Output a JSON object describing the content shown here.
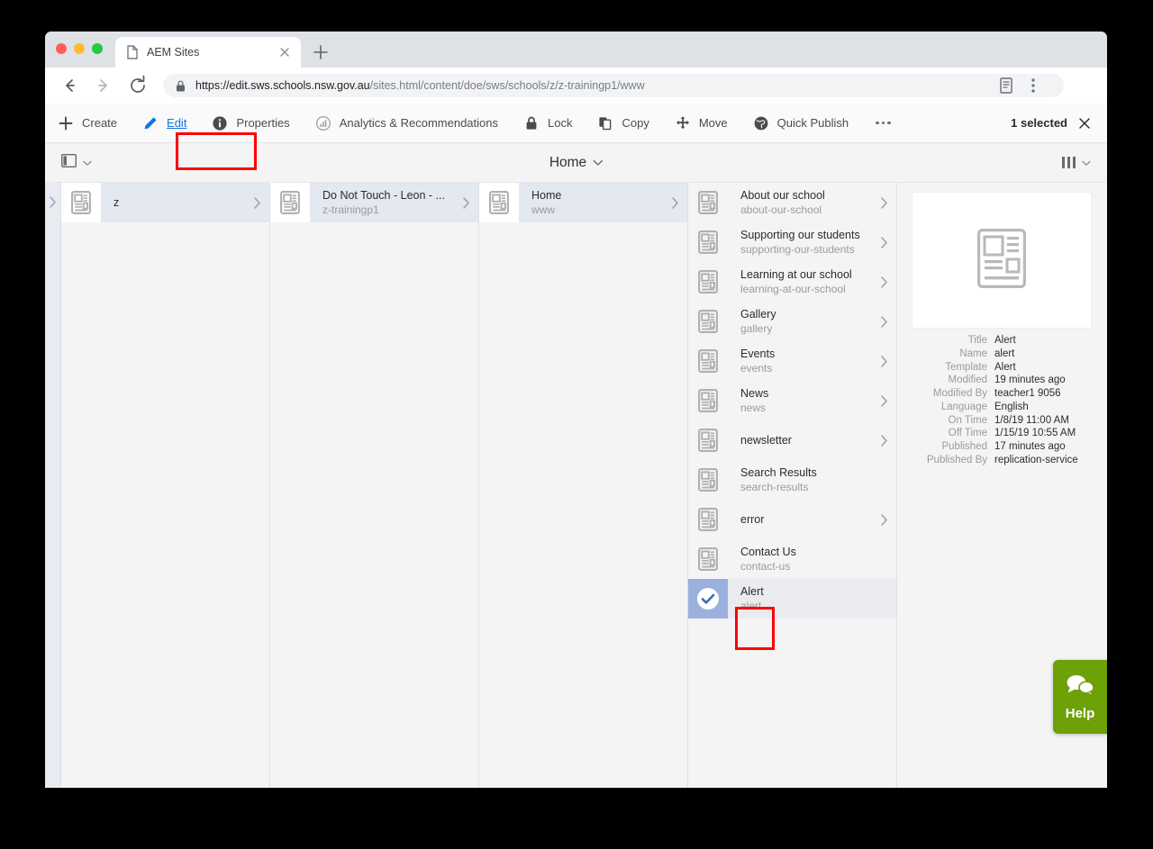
{
  "browser": {
    "tab": {
      "title": "AEM Sites",
      "favicon": "page-icon",
      "close": "close-icon"
    },
    "new_tab": "new-tab-icon",
    "nav": {
      "back": "back-arrow-icon",
      "forward": "forward-arrow-icon",
      "reload": "reload-icon"
    },
    "omnibox": {
      "lock": "lock-icon",
      "url_host": "https://edit.sws.schools.nsw.gov.au",
      "url_path": "/sites.html/content/doe/sws/schools/z/z-trainingp1/www",
      "reader": "reader-mode-icon",
      "menu": "browser-menu-icon"
    }
  },
  "action_bar": {
    "items": [
      {
        "id": "create",
        "label": "Create",
        "icon": "plus-icon"
      },
      {
        "id": "edit",
        "label": "Edit",
        "icon": "pencil-icon"
      },
      {
        "id": "properties",
        "label": "Properties",
        "icon": "info-icon"
      },
      {
        "id": "analytics",
        "label": "Analytics & Recommendations",
        "icon": "analytics-icon"
      },
      {
        "id": "lock",
        "label": "Lock",
        "icon": "lock-icon"
      },
      {
        "id": "copy",
        "label": "Copy",
        "icon": "copy-icon"
      },
      {
        "id": "move",
        "label": "Move",
        "icon": "move-icon"
      },
      {
        "id": "publish",
        "label": "Quick Publish",
        "icon": "globe-icon"
      }
    ],
    "more": "more-icon",
    "selection_count": "1 selected",
    "clear": "close-icon",
    "edit_accent_color": "#1473e6"
  },
  "rail_bar": {
    "rail_toggle_icon": "rail-panel-icon",
    "breadcrumb_label": "Home",
    "breadcrumb_caret": "chevron-down-icon",
    "view_switch_icon": "column-view-icon",
    "view_switch_caret": "chevron-down-icon"
  },
  "columns": [
    {
      "id": "col-0",
      "rows": [],
      "edge_chevron": "chevron-right-icon"
    },
    {
      "id": "col-1",
      "rows": [
        {
          "title": "z",
          "sub": "",
          "state": "active",
          "icon": "page-template-icon",
          "chevron": "chevron-right-icon"
        }
      ]
    },
    {
      "id": "col-2",
      "rows": [
        {
          "title": "Do Not Touch - Leon - ...",
          "sub": "z-trainingp1",
          "state": "active",
          "icon": "page-template-icon",
          "chevron": "chevron-right-icon"
        }
      ]
    },
    {
      "id": "col-3",
      "rows": [
        {
          "title": "Home",
          "sub": "www",
          "state": "active",
          "icon": "page-template-icon",
          "chevron": "chevron-right-icon"
        }
      ]
    },
    {
      "id": "col-4",
      "rows": [
        {
          "title": "About our school",
          "sub": "about-our-school",
          "state": "normal",
          "icon": "page-template-icon",
          "chevron": "chevron-right-icon"
        },
        {
          "title": "Supporting our students",
          "sub": "supporting-our-students",
          "state": "normal",
          "icon": "page-template-icon",
          "chevron": "chevron-right-icon"
        },
        {
          "title": "Learning at our school",
          "sub": "learning-at-our-school",
          "state": "normal",
          "icon": "page-template-icon",
          "chevron": "chevron-right-icon"
        },
        {
          "title": "Gallery",
          "sub": "gallery",
          "state": "normal",
          "icon": "page-template-icon",
          "chevron": "chevron-right-icon"
        },
        {
          "title": "Events",
          "sub": "events",
          "state": "normal",
          "icon": "page-template-icon",
          "chevron": "chevron-right-icon"
        },
        {
          "title": "News",
          "sub": "news",
          "state": "normal",
          "icon": "page-template-icon",
          "chevron": "chevron-right-icon"
        },
        {
          "title": "newsletter",
          "sub": "",
          "state": "normal",
          "icon": "page-template-icon",
          "chevron": "chevron-right-icon"
        },
        {
          "title": "Search Results",
          "sub": "search-results",
          "state": "normal",
          "icon": "page-template-icon",
          "chevron": ""
        },
        {
          "title": "error",
          "sub": "",
          "state": "normal",
          "icon": "page-template-icon",
          "chevron": "chevron-right-icon"
        },
        {
          "title": "Contact Us",
          "sub": "contact-us",
          "state": "normal",
          "icon": "page-template-icon",
          "chevron": ""
        },
        {
          "title": "Alert",
          "sub": "alert",
          "state": "selected",
          "icon": "checkmark-circle-icon",
          "chevron": ""
        }
      ]
    }
  ],
  "detail": {
    "thumbnail_icon": "page-template-icon",
    "properties": [
      {
        "key": "Title",
        "value": "Alert"
      },
      {
        "key": "Name",
        "value": "alert"
      },
      {
        "key": "Template",
        "value": "Alert"
      },
      {
        "key": "Modified",
        "value": "19 minutes ago"
      },
      {
        "key": "Modified By",
        "value": "teacher1 9056"
      },
      {
        "key": "Language",
        "value": "English"
      },
      {
        "key": "On Time",
        "value": "1/8/19 11:00 AM"
      },
      {
        "key": "Off Time",
        "value": "1/15/19 10:55 AM"
      },
      {
        "key": "Published",
        "value": "17 minutes ago"
      },
      {
        "key": "Published By",
        "value": "replication-service"
      }
    ]
  },
  "help": {
    "label": "Help",
    "icon": "chat-bubbles-icon",
    "color": "#6ea007"
  },
  "annotations": {
    "color": "#ff0000",
    "boxes": [
      {
        "id": "edit-button-highlight",
        "target": "Edit"
      },
      {
        "id": "selected-item-highlight",
        "target": "Alert"
      }
    ]
  }
}
